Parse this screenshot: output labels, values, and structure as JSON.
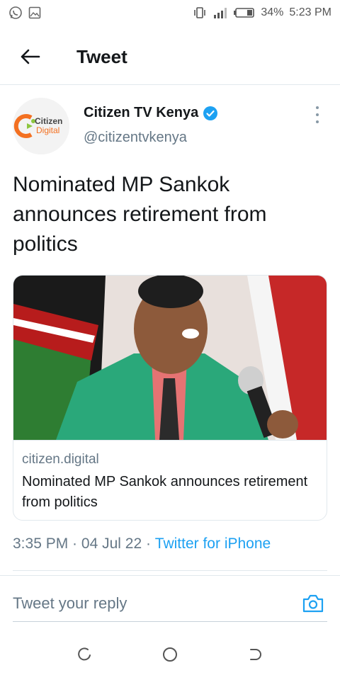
{
  "status_bar": {
    "battery": "34%",
    "time": "5:23 PM",
    "icons": [
      "whatsapp-icon",
      "image-icon",
      "vibrate-icon",
      "signal-icon",
      "battery-icon"
    ]
  },
  "header": {
    "title": "Tweet",
    "back_icon": "arrow-left-icon"
  },
  "author": {
    "name": "Citizen TV Kenya",
    "handle": "@citizentvkenya",
    "verified": true,
    "avatar_text_1": "Citizen",
    "avatar_text_2": "Digital"
  },
  "tweet": {
    "text": "Nominated MP Sankok announces retirement from politics"
  },
  "card": {
    "domain": "citizen.digital",
    "title": "Nominated MP Sankok announces retirement from politics"
  },
  "meta": {
    "time": "3:35 PM",
    "separator": " · ",
    "date": "04 Jul 22",
    "source": "Twitter for iPhone"
  },
  "reply": {
    "placeholder": "Tweet your reply"
  },
  "colors": {
    "accent": "#1da1f2",
    "secondary_text": "#657786",
    "primary_text": "#14171a"
  }
}
